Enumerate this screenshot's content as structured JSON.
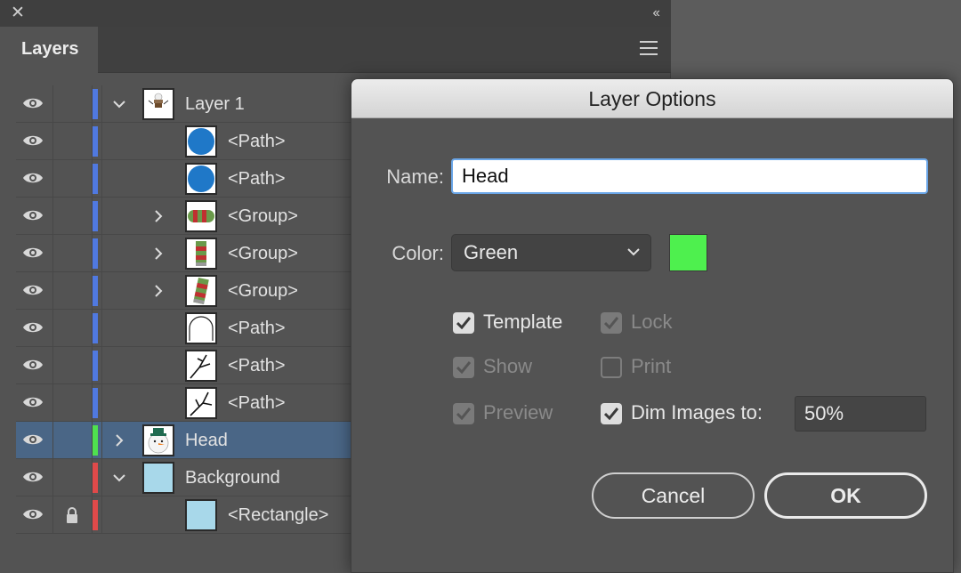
{
  "panel": {
    "close_glyph": "✕",
    "collapse_glyph": "‹‹",
    "tab_label": "Layers"
  },
  "layers": [
    {
      "name": "Layer 1",
      "indent": 0,
      "twirl": "down",
      "thumb": "snowman",
      "color": "#5079e0",
      "locked": false,
      "selected": false
    },
    {
      "name": "<Path>",
      "indent": 1,
      "twirl": "none",
      "thumb": "circle",
      "color": "#5079e0",
      "locked": false,
      "selected": false
    },
    {
      "name": "<Path>",
      "indent": 1,
      "twirl": "none",
      "thumb": "circle",
      "color": "#5079e0",
      "locked": false,
      "selected": false
    },
    {
      "name": "<Group>",
      "indent": 1,
      "twirl": "right",
      "thumb": "scarf-h",
      "color": "#5079e0",
      "locked": false,
      "selected": false
    },
    {
      "name": "<Group>",
      "indent": 1,
      "twirl": "right",
      "thumb": "scarf-v",
      "color": "#5079e0",
      "locked": false,
      "selected": false
    },
    {
      "name": "<Group>",
      "indent": 1,
      "twirl": "right",
      "thumb": "scarf-d",
      "color": "#5079e0",
      "locked": false,
      "selected": false
    },
    {
      "name": "<Path>",
      "indent": 1,
      "twirl": "none",
      "thumb": "arch",
      "color": "#5079e0",
      "locked": false,
      "selected": false
    },
    {
      "name": "<Path>",
      "indent": 1,
      "twirl": "none",
      "thumb": "branch",
      "color": "#5079e0",
      "locked": false,
      "selected": false
    },
    {
      "name": "<Path>",
      "indent": 1,
      "twirl": "none",
      "thumb": "twig",
      "color": "#5079e0",
      "locked": false,
      "selected": false
    },
    {
      "name": "Head",
      "indent": 0,
      "twirl": "right",
      "thumb": "head",
      "color": "#4fe04f",
      "locked": false,
      "selected": true
    },
    {
      "name": "Background",
      "indent": 0,
      "twirl": "down",
      "thumb": "bluebox",
      "color": "#e04a4a",
      "locked": false,
      "selected": false
    },
    {
      "name": "<Rectangle>",
      "indent": 1,
      "twirl": "none",
      "thumb": "bluebox",
      "color": "#e04a4a",
      "locked": true,
      "selected": false
    }
  ],
  "dialog": {
    "title": "Layer Options",
    "name_label": "Name:",
    "name_value": "Head",
    "color_label": "Color:",
    "color_value": "Green",
    "swatch_color": "#4ef04e",
    "options": {
      "template": {
        "label": "Template",
        "checked": true,
        "enabled": true
      },
      "lock": {
        "label": "Lock",
        "checked": true,
        "enabled": false
      },
      "show": {
        "label": "Show",
        "checked": true,
        "enabled": false
      },
      "print": {
        "label": "Print",
        "checked": false,
        "enabled": false
      },
      "preview": {
        "label": "Preview",
        "checked": true,
        "enabled": false
      },
      "dim": {
        "label": "Dim Images to:",
        "checked": true,
        "enabled": true
      }
    },
    "dim_value": "50%",
    "cancel_label": "Cancel",
    "ok_label": "OK"
  }
}
